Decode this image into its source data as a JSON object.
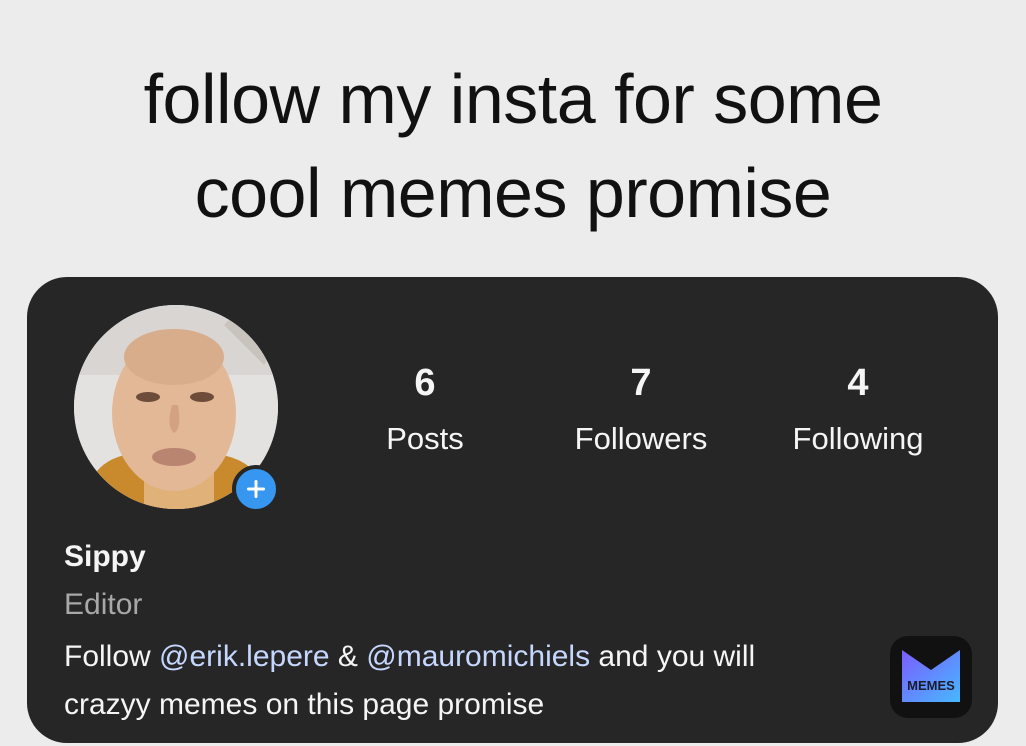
{
  "caption": {
    "line1": "follow my insta for some",
    "line2": "cool memes promise"
  },
  "profile": {
    "stats": [
      {
        "value": "6",
        "label": "Posts"
      },
      {
        "value": "7",
        "label": "Followers"
      },
      {
        "value": "4",
        "label": "Following"
      }
    ],
    "name": "Sippy",
    "role": "Editor",
    "bio": {
      "part1": "Follow ",
      "mention1": "@erik.lepere",
      "part2": " & ",
      "mention2": "@mauromichiels",
      "part3": " and you will",
      "line2": "crazyy memes on this page promise"
    },
    "add_badge_icon": "plus-icon"
  },
  "watermark": {
    "text": "MEMES",
    "icon": "memes-app-logo"
  },
  "colors": {
    "background": "#ececec",
    "card": "#262626",
    "accent": "#3797f0",
    "mention": "#c6d7ff",
    "muted": "#a8a8a8"
  }
}
